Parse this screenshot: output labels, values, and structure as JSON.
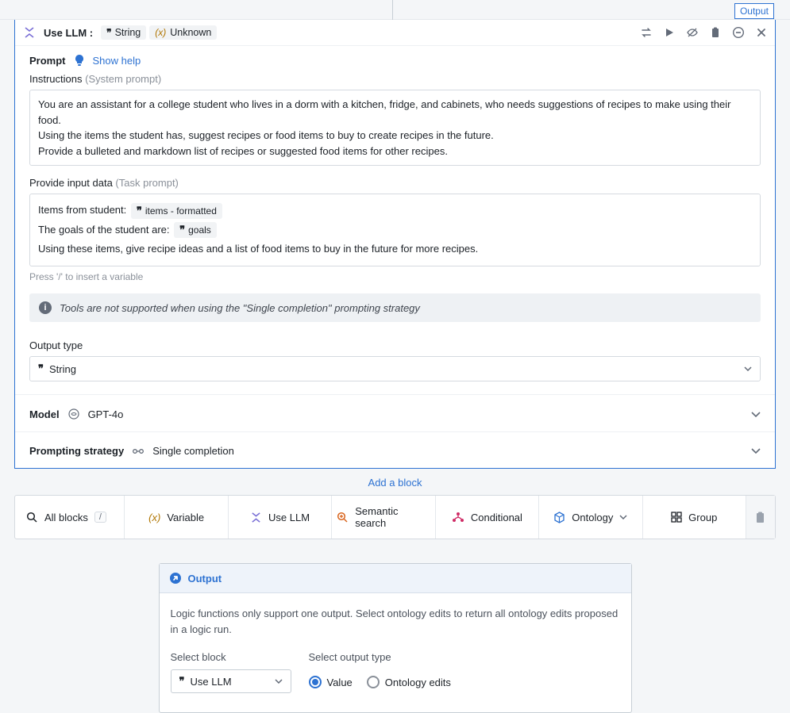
{
  "top_tab": {
    "output_label": "Output"
  },
  "block": {
    "title": "Use LLM :",
    "chips": [
      {
        "icon": "quote",
        "label": "String"
      },
      {
        "icon": "var",
        "label": "Unknown"
      }
    ]
  },
  "prompt": {
    "label": "Prompt",
    "show_help": "Show help",
    "instructions_label": "Instructions",
    "instructions_hint": "(System prompt)",
    "instructions_text": "You are an assistant for a college student who lives in a dorm with a kitchen, fridge, and cabinets, who needs suggestions of recipes to make using their food.\nUsing the items the student has, suggest recipes or food items to buy to create recipes in the future.\nProvide a bulleted and markdown list of recipes or suggested food items for other recipes.",
    "input_label": "Provide input data",
    "input_hint": "(Task prompt)",
    "task_line1_pre": "Items from student: ",
    "task_chip1": "items - formatted",
    "task_line2_pre": "The goals of the student are: ",
    "task_chip2": "goals",
    "task_line3": "Using these items, give recipe ideas and a list of food items to buy in the future for more recipes.",
    "variable_hint": "Press '/' to insert a variable"
  },
  "info_banner": "Tools are not supported when using the \"Single completion\" prompting strategy",
  "output_type": {
    "label": "Output type",
    "value": "String"
  },
  "model": {
    "label": "Model",
    "value": "GPT-4o"
  },
  "strategy": {
    "label": "Prompting strategy",
    "value": "Single completion"
  },
  "add_block": "Add a block",
  "toolbar": {
    "all_blocks": "All blocks",
    "kbd": "/",
    "variable": "Variable",
    "use_llm": "Use LLM",
    "semantic": "Semantic search",
    "conditional": "Conditional",
    "ontology": "Ontology",
    "group": "Group"
  },
  "output_panel": {
    "title": "Output",
    "description": "Logic functions only support one output. Select ontology edits to return all ontology edits proposed in a logic run.",
    "select_block_label": "Select block",
    "select_block_value": "Use LLM",
    "output_type_label": "Select output type",
    "radio_value": "Value",
    "radio_edits": "Ontology edits"
  },
  "colors": {
    "accent": "#2d72d2"
  }
}
